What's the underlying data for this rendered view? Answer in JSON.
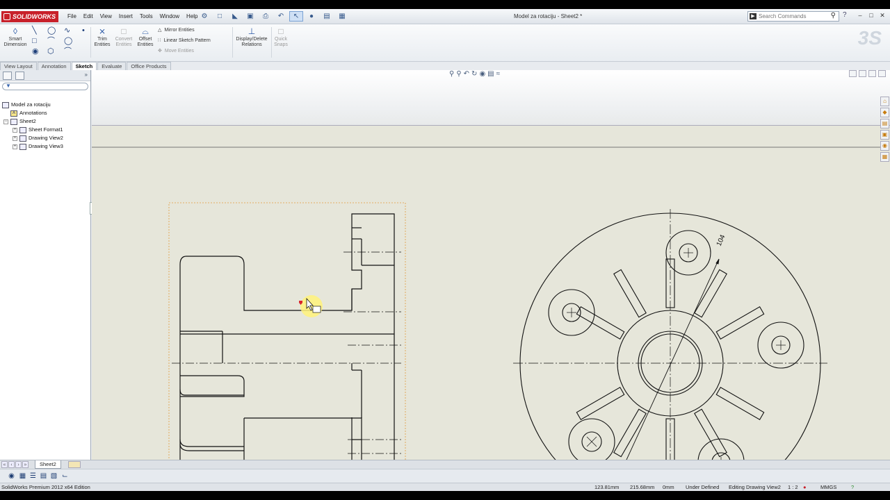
{
  "app": {
    "brand": "SOLIDWORKS",
    "document_title": "Model za rotaciju - Sheet2 *"
  },
  "menu": [
    "File",
    "Edit",
    "View",
    "Insert",
    "Tools",
    "Window",
    "Help"
  ],
  "search": {
    "placeholder": "Search Commands"
  },
  "command_manager": {
    "smart_dimension": [
      "Smart",
      "Dimension"
    ],
    "trim_entities": [
      "Trim",
      "Entities"
    ],
    "convert_entities": [
      "Convert",
      "Entities"
    ],
    "offset_entities": [
      "Offset",
      "Entities"
    ],
    "mirror_entities": "Mirror Entities",
    "linear_sketch_pattern": "Linear Sketch Pattern",
    "move_entities": "Move Entities",
    "display_delete_relations": [
      "Display/Delete",
      "Relations"
    ],
    "quick_snaps": [
      "Quick",
      "Snaps"
    ]
  },
  "tabs": [
    "View Layout",
    "Annotation",
    "Sketch",
    "Evaluate",
    "Office Products"
  ],
  "active_tab": "Sketch",
  "feature_tree": {
    "root": "Model za rotaciju",
    "items": [
      {
        "label": "Annotations",
        "icon": "annotations-icon"
      },
      {
        "label": "Sheet2",
        "icon": "sheet-icon"
      },
      {
        "label": "Sheet Format1",
        "icon": "sheet-format-icon"
      },
      {
        "label": "Drawing View2",
        "icon": "drawing-view-icon"
      },
      {
        "label": "Drawing View3",
        "icon": "drawing-view-icon"
      }
    ]
  },
  "drawing": {
    "dimension_text": "104"
  },
  "sheet_tab": "Sheet2",
  "status": {
    "edition": "SolidWorks Premium 2012 x64 Edition",
    "x": "123.81mm",
    "y": "215.68mm",
    "z": "0mm",
    "state": "Under Defined",
    "editing": "Editing Drawing View2",
    "scale": "1 : 2",
    "units": "MMGS"
  },
  "colors": {
    "accent": "#c8202a",
    "sheet": "#e6e6da",
    "cursor_highlight": "#fff27a"
  }
}
